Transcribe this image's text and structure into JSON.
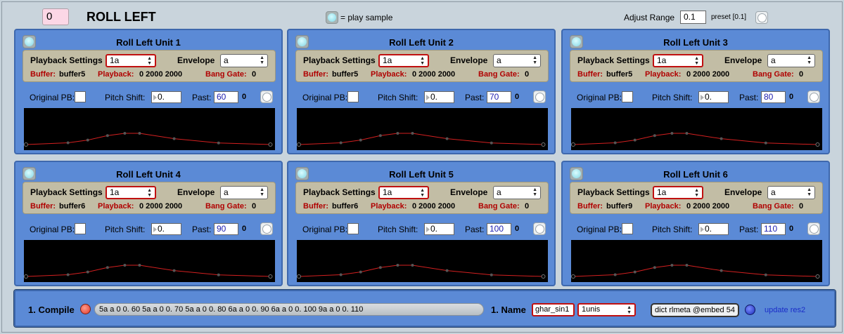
{
  "header": {
    "number": "0",
    "title": "ROLL LEFT",
    "legend_text": "= play sample",
    "adjust_label": "Adjust Range",
    "adjust_value": "0.1",
    "preset_label": "preset [0.1]"
  },
  "labels": {
    "playback_settings": "Playback Settings",
    "envelope": "Envelope",
    "buffer": "Buffer:",
    "playback": "Playback:",
    "bang_gate": "Bang Gate:",
    "original_pb": "Original PB:",
    "pitch_shift": "Pitch Shift:",
    "past": "Past:"
  },
  "units": [
    {
      "title": "Roll Left Unit 1",
      "playback_setting": "1a",
      "envelope": "a",
      "buffer": "buffer5",
      "playback": "0 2000 2000",
      "bang_gate": "0",
      "pitch_shift": "0.",
      "past": "60",
      "past_out": "0"
    },
    {
      "title": "Roll Left Unit 2",
      "playback_setting": "1a",
      "envelope": "a",
      "buffer": "buffer5",
      "playback": "0 2000 2000",
      "bang_gate": "0",
      "pitch_shift": "0.",
      "past": "70",
      "past_out": "0"
    },
    {
      "title": "Roll Left Unit 3",
      "playback_setting": "1a",
      "envelope": "a",
      "buffer": "buffer5",
      "playback": "0 2000 2000",
      "bang_gate": "0",
      "pitch_shift": "0.",
      "past": "80",
      "past_out": "0"
    },
    {
      "title": "Roll Left Unit 4",
      "playback_setting": "1a",
      "envelope": "a",
      "buffer": "buffer6",
      "playback": "0 2000 2000",
      "bang_gate": "0",
      "pitch_shift": "0.",
      "past": "90",
      "past_out": "0"
    },
    {
      "title": "Roll Left Unit 5",
      "playback_setting": "1a",
      "envelope": "a",
      "buffer": "buffer6",
      "playback": "0 2000 2000",
      "bang_gate": "0",
      "pitch_shift": "0.",
      "past": "100",
      "past_out": "0"
    },
    {
      "title": "Roll Left Unit 6",
      "playback_setting": "1a",
      "envelope": "a",
      "buffer": "buffer9",
      "playback": "0 2000 2000",
      "bang_gate": "0",
      "pitch_shift": "0.",
      "past": "110",
      "past_out": "0"
    }
  ],
  "envelope_curve": {
    "points": [
      [
        0,
        0
      ],
      [
        0.17,
        0.08
      ],
      [
        0.25,
        0.2
      ],
      [
        0.33,
        0.4
      ],
      [
        0.4,
        0.5
      ],
      [
        0.46,
        0.5
      ],
      [
        0.6,
        0.26
      ],
      [
        0.78,
        0.07
      ],
      [
        0.99,
        0
      ]
    ],
    "line_color": "#d42020",
    "point_color": "#555555"
  },
  "compile": {
    "label": "1. Compile",
    "message": "5a a 0 0. 60 5a a 0 0. 70 5a a 0 0. 80 6a a 0 0. 90 6a a 0 0. 100 9a a 0 0. 110",
    "name_label": "1. Name",
    "name_value": "ghar_sin1",
    "units_value": "1unis",
    "dict_label": "dict rlmeta @embed 54",
    "update_label": "update res2"
  },
  "colors": {
    "panel": "#5b8ad6",
    "settings_box": "#c2bda5",
    "accent_red": "#c01010",
    "background": "#c9d4dc"
  }
}
